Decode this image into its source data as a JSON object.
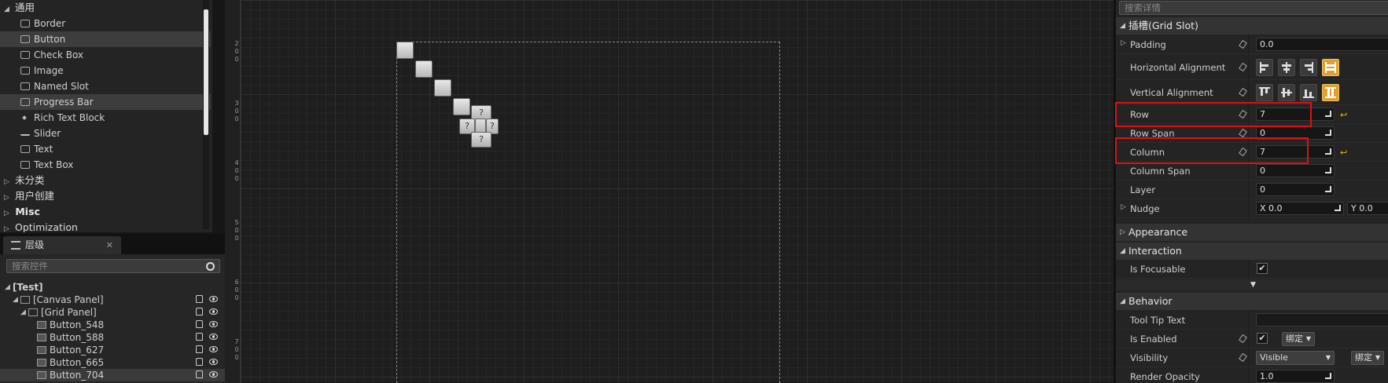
{
  "palette": {
    "categories": {
      "common": "通用",
      "uncategorized": "未分类",
      "user_created": "用户创建",
      "misc": "Misc",
      "optimization": "Optimization"
    },
    "common_items": [
      {
        "label": "Border",
        "icon": "border-icon",
        "selected": false
      },
      {
        "label": "Button",
        "icon": "button-icon",
        "selected": true
      },
      {
        "label": "Check Box",
        "icon": "checkbox-icon",
        "selected": false
      },
      {
        "label": "Image",
        "icon": "image-icon",
        "selected": false
      },
      {
        "label": "Named Slot",
        "icon": "named-slot-icon",
        "selected": false
      },
      {
        "label": "Progress Bar",
        "icon": "progress-bar-icon",
        "selected": true
      },
      {
        "label": "Rich Text Block",
        "icon": "rich-text-icon",
        "selected": false
      },
      {
        "label": "Slider",
        "icon": "slider-icon",
        "selected": false
      },
      {
        "label": "Text",
        "icon": "text-icon",
        "selected": false
      },
      {
        "label": "Text Box",
        "icon": "text-box-icon",
        "selected": false
      }
    ]
  },
  "hierarchy": {
    "tab_label": "层级",
    "close": "✕",
    "search_placeholder": "搜索控件",
    "tree": [
      {
        "label": "[Test]",
        "level": 0
      },
      {
        "label": "[Canvas Panel]",
        "level": 1
      },
      {
        "label": "[Grid Panel]",
        "level": 2
      },
      {
        "label": "Button_548",
        "level": 3
      },
      {
        "label": "Button_588",
        "level": 3
      },
      {
        "label": "Button_627",
        "level": 3
      },
      {
        "label": "Button_665",
        "level": 3
      },
      {
        "label": "Button_704",
        "level": 3,
        "selected": true
      }
    ]
  },
  "canvas": {
    "ruler_labels": [
      "2",
      "0",
      "0",
      "3",
      "0",
      "0",
      "4",
      "0",
      "0",
      "5",
      "0",
      "0",
      "6",
      "0",
      "0",
      "7",
      "0",
      "0"
    ],
    "question_mark": "?"
  },
  "details": {
    "search_placeholder": "搜索详情",
    "sections": {
      "grid_slot": "插槽(Grid Slot)",
      "appearance": "Appearance",
      "interaction": "Interaction",
      "behavior": "Behavior"
    },
    "padding": {
      "label": "Padding",
      "value": "0.0"
    },
    "horizontal_alignment": {
      "label": "Horizontal Alignment"
    },
    "vertical_alignment": {
      "label": "Vertical Alignment"
    },
    "row": {
      "label": "Row",
      "value": "7"
    },
    "row_span": {
      "label": "Row Span",
      "value": "0"
    },
    "column": {
      "label": "Column",
      "value": "7"
    },
    "column_span": {
      "label": "Column Span",
      "value": "0"
    },
    "layer": {
      "label": "Layer",
      "value": "0"
    },
    "nudge": {
      "label": "Nudge",
      "x": "X  0.0",
      "y": "Y  0.0"
    },
    "is_focusable": {
      "label": "Is Focusable",
      "checked": true
    },
    "tool_tip_text": {
      "label": "Tool Tip Text",
      "value": ""
    },
    "is_enabled": {
      "label": "Is Enabled",
      "checked": true,
      "bind_label": "绑定"
    },
    "visibility": {
      "label": "Visibility",
      "value": "Visible",
      "bind_label": "绑定"
    },
    "render_opacity": {
      "label": "Render Opacity",
      "value": "1.0"
    }
  },
  "colors": {
    "annotation": "#e01010",
    "active_alignment": "#e0a030",
    "reset_arrow": "#e0c000"
  }
}
